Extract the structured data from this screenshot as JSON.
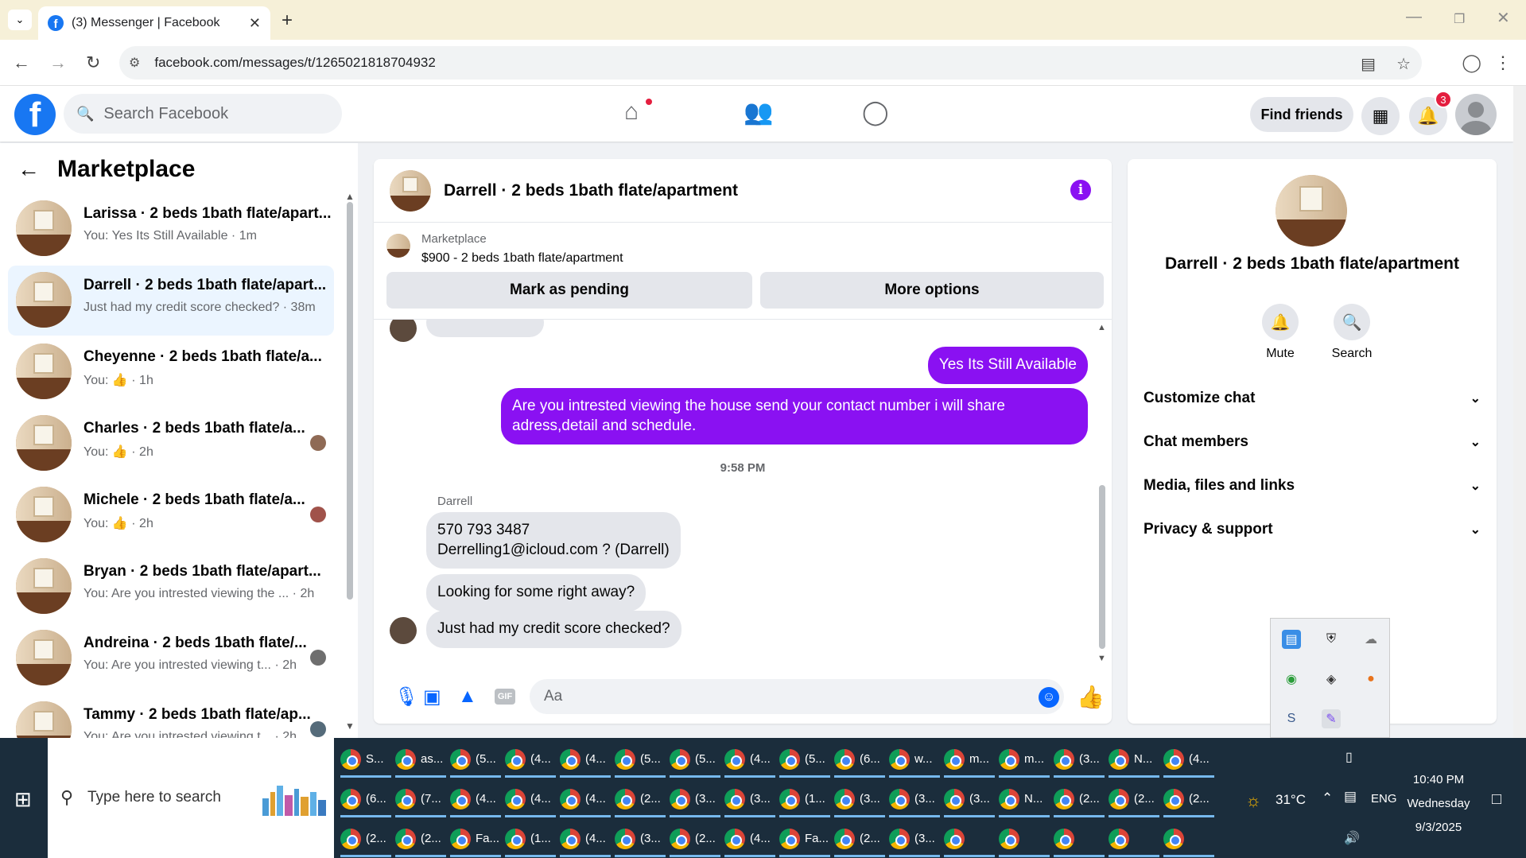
{
  "browser": {
    "tab_title": "(3) Messenger | Facebook",
    "url": "facebook.com/messages/t/1265021818704932"
  },
  "fb_header": {
    "search_placeholder": "Search Facebook",
    "find_friends": "Find friends",
    "notification_count": "3"
  },
  "left_panel": {
    "title": "Marketplace",
    "conversations": [
      {
        "name": "Larissa · 2 beds 1bath flate/apart...",
        "snippet": "You: Yes Its Still Available · 1m",
        "active": false
      },
      {
        "name": "Darrell · 2 beds 1bath flate/apart...",
        "snippet": "Just had my credit score checked? · 38m",
        "active": true
      },
      {
        "name": "Cheyenne · 2 beds 1bath flate/a...",
        "snippet_prefix": "You:",
        "snippet_suffix": "· 1h",
        "active": false
      },
      {
        "name": "Charles · 2 beds 1bath flate/a...",
        "snippet_prefix": "You:",
        "snippet_suffix": "· 2h",
        "active": false
      },
      {
        "name": "Michele · 2 beds 1bath flate/a...",
        "snippet_prefix": "You:",
        "snippet_suffix": "· 2h",
        "active": false
      },
      {
        "name": "Bryan · 2 beds 1bath flate/apart...",
        "snippet": "You: Are you intrested viewing the ... · 2h",
        "active": false
      },
      {
        "name": "Andreina · 2 beds 1bath flate/...",
        "snippet": "You: Are you intrested viewing t... · 2h",
        "active": false
      },
      {
        "name": "Tammy · 2 beds 1bath flate/ap...",
        "snippet": "You: Are you intrested viewing t... · 2h",
        "active": false
      }
    ]
  },
  "chat": {
    "title": "Darrell · 2 beds 1bath flate/apartment",
    "listing_source": "Marketplace",
    "listing_detail": "$900 - 2 beds 1bath flate/apartment",
    "mark_pending": "Mark as pending",
    "more_options": "More options",
    "out_msg_1": "Yes Its Still Available",
    "out_msg_2": "Are you intrested viewing the house send your contact number i will share adress,detail and schedule.",
    "timestamp": "9:58 PM",
    "sender": "Darrell",
    "in_msg_1_line1": "570 793 3487",
    "in_msg_1_line2": "Derrelling1@icloud.com ? (Darrell)",
    "in_msg_2": "Looking for some right away?",
    "in_msg_3": "Just had my credit score checked?",
    "composer_placeholder": "Aa",
    "gif_label": "GIF"
  },
  "right_panel": {
    "name": "Darrell · 2 beds 1bath flate/apartment",
    "mute": "Mute",
    "search": "Search",
    "sections": [
      "Customize chat",
      "Chat members",
      "Media, files and links",
      "Privacy & support"
    ]
  },
  "taskbar": {
    "search_placeholder": "Type here to search",
    "weather": "31°C",
    "lang": "ENG",
    "time": "10:40 PM",
    "day": "Wednesday",
    "date": "9/3/2025",
    "row1": [
      "S...",
      "as...",
      "(5...",
      "(4...",
      "(4...",
      "(5...",
      "(5...",
      "(4...",
      "(5...",
      "(6...",
      "w...",
      "m...",
      "m...",
      "(3...",
      "N...",
      "(4..."
    ],
    "row2": [
      "(6...",
      "(7...",
      "(4...",
      "(4...",
      "(4...",
      "(2...",
      "(3...",
      "(3...",
      "(1...",
      "(3...",
      "(3...",
      "(3...",
      "N...",
      "(2...",
      "(2...",
      "(2..."
    ],
    "row3": [
      "(2...",
      "(2...",
      "Fa...",
      "(1...",
      "(4...",
      "(3...",
      "(2...",
      "(4...",
      "Fa...",
      "(2...",
      "(3...",
      "",
      "",
      "",
      "",
      ""
    ]
  },
  "colors": {
    "fb_blue": "#1877f2",
    "messenger_purple": "#8a11f2",
    "active_conv_bg": "#ebf5ff",
    "taskbar_bg": "#1b2d3c"
  }
}
